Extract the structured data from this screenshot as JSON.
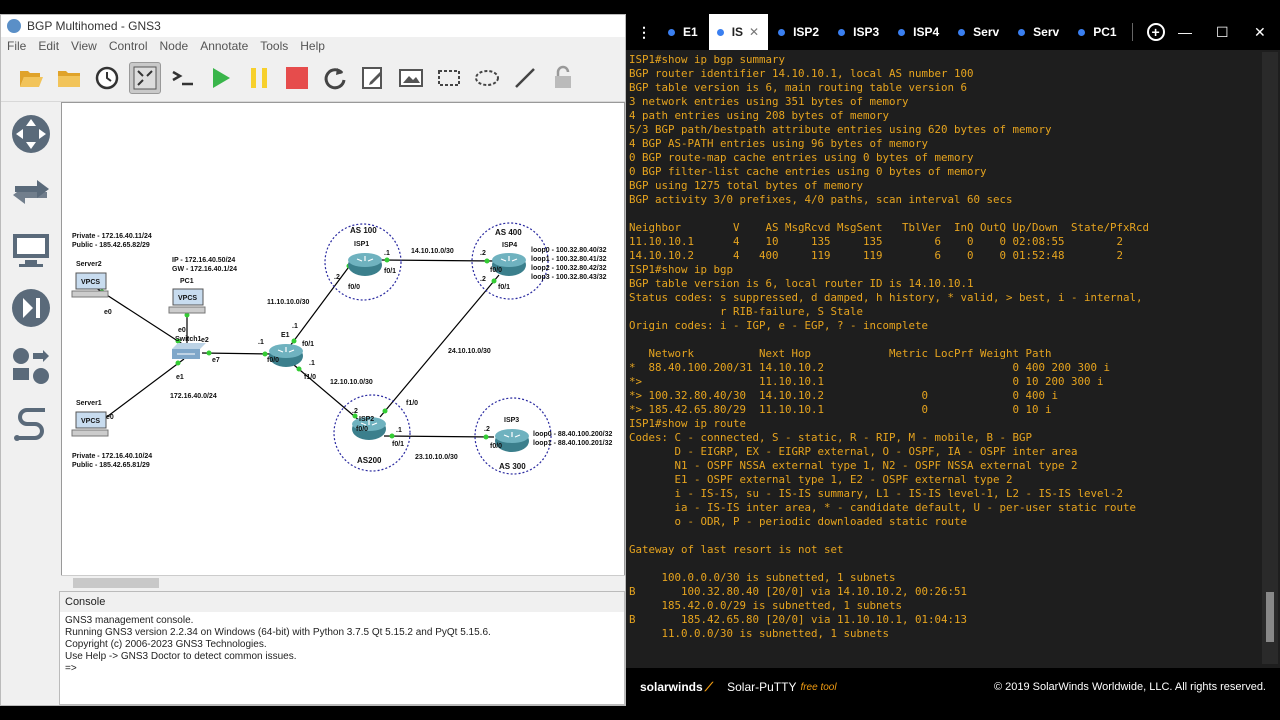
{
  "gns3": {
    "title": "BGP Multihomed - GNS3",
    "menu": [
      "File",
      "Edit",
      "View",
      "Control",
      "Node",
      "Annotate",
      "Tools",
      "Help"
    ],
    "toolbar_icons": [
      "folder-open-icon",
      "folder-icon",
      "clock-icon",
      "console-all-icon",
      "terminal-icon",
      "play-icon",
      "pause-icon",
      "stop-icon",
      "reload-icon",
      "edit-note-icon",
      "image-icon",
      "rectangle-icon",
      "ellipse-icon",
      "line-icon",
      "lock-icon"
    ],
    "left_icons": [
      "router-icon",
      "switch-icon",
      "end-device-icon",
      "security-device-icon",
      "all-devices-icon",
      "link-icon"
    ],
    "diagram": {
      "labels": {
        "server2_info_1": "Private - 172.16.40.11/24",
        "server2_info_2": "Public - 185.42.65.82/29",
        "server2": "Server2",
        "server1_info_1": "Private - 172.16.40.10/24",
        "server1_info_2": "Public - 185.42.65.81/29",
        "server1": "Server1",
        "pc1": "PC1",
        "pc1_ip": "IP - 172.16.40.50/24",
        "pc1_gw": "GW - 172.16.40.1/24",
        "switch1": "Switch1",
        "lan": "172.16.40.0/24",
        "e1": "E1",
        "as100": "AS 100",
        "isp1": "ISP1",
        "as400": "AS 400",
        "isp4": "ISP4",
        "as200": "AS200",
        "isp2": "ISP2",
        "as300": "AS 300",
        "isp3": "ISP3",
        "net_isp1_isp4": "14.10.10.0/30",
        "net_e1_isp1": "11.10.10.0/30",
        "net_e1_isp2": "12.10.10.0/30",
        "net_isp2_isp4": "24.10.10.0/30",
        "net_isp2_isp3": "23.10.10.0/30",
        "isp4_loop0": "loop0 - 100.32.80.40/32",
        "isp4_loop1": "loop1 - 100.32.80.41/32",
        "isp4_loop2": "loop2 - 100.32.80.42/32",
        "isp4_loop3": "loop3 - 100.32.80.43/32",
        "isp3_loop0": "loop0 - 88.40.100.200/32",
        "isp3_loop1": "loop1 - 88.40.100.201/32",
        "vpcs": "VPCS",
        "if_e0": "e0",
        "if_e1": "e1",
        "if_e2": "e2",
        "if_e7": "e7",
        "if_f00": "f0/0",
        "if_f01": "f0/1",
        "if_f10": "f1/0",
        "ip_1": ".1",
        "ip_2": ".2"
      }
    },
    "console": {
      "title": "Console",
      "lines": [
        "GNS3 management console.",
        "Running GNS3 version 2.2.34 on Windows (64-bit) with Python 3.7.5 Qt 5.15.2 and PyQt 5.15.6.",
        "Copyright (c) 2006-2023 GNS3 Technologies.",
        "Use Help -> GNS3 Doctor to detect common issues.",
        "",
        "=>"
      ]
    }
  },
  "putty": {
    "tabs": [
      {
        "label": "E1",
        "active": false
      },
      {
        "label": "IS",
        "active": true
      },
      {
        "label": "ISP2",
        "active": false
      },
      {
        "label": "ISP3",
        "active": false
      },
      {
        "label": "ISP4",
        "active": false
      },
      {
        "label": "Serv",
        "active": false
      },
      {
        "label": "Serv",
        "active": false
      },
      {
        "label": "PC1",
        "active": false
      }
    ],
    "window_buttons": {
      "minimize": "—",
      "maximize": "☐",
      "close": "✕"
    },
    "terminal_lines": [
      "ISP1#show ip bgp summary",
      "BGP router identifier 14.10.10.1, local AS number 100",
      "BGP table version is 6, main routing table version 6",
      "3 network entries using 351 bytes of memory",
      "4 path entries using 208 bytes of memory",
      "5/3 BGP path/bestpath attribute entries using 620 bytes of memory",
      "4 BGP AS-PATH entries using 96 bytes of memory",
      "0 BGP route-map cache entries using 0 bytes of memory",
      "0 BGP filter-list cache entries using 0 bytes of memory",
      "BGP using 1275 total bytes of memory",
      "BGP activity 3/0 prefixes, 4/0 paths, scan interval 60 secs",
      "",
      "Neighbor        V    AS MsgRcvd MsgSent   TblVer  InQ OutQ Up/Down  State/PfxRcd",
      "11.10.10.1      4    10     135     135        6    0    0 02:08:55        2",
      "14.10.10.2      4   400     119     119        6    0    0 01:52:48        2",
      "ISP1#show ip bgp",
      "BGP table version is 6, local router ID is 14.10.10.1",
      "Status codes: s suppressed, d damped, h history, * valid, > best, i - internal,",
      "              r RIB-failure, S Stale",
      "Origin codes: i - IGP, e - EGP, ? - incomplete",
      "",
      "   Network          Next Hop            Metric LocPrf Weight Path",
      "*  88.40.100.200/31 14.10.10.2                             0 400 200 300 i",
      "*>                  11.10.10.1                             0 10 200 300 i",
      "*> 100.32.80.40/30  14.10.10.2               0             0 400 i",
      "*> 185.42.65.80/29  11.10.10.1               0             0 10 i",
      "ISP1#show ip route",
      "Codes: C - connected, S - static, R - RIP, M - mobile, B - BGP",
      "       D - EIGRP, EX - EIGRP external, O - OSPF, IA - OSPF inter area",
      "       N1 - OSPF NSSA external type 1, N2 - OSPF NSSA external type 2",
      "       E1 - OSPF external type 1, E2 - OSPF external type 2",
      "       i - IS-IS, su - IS-IS summary, L1 - IS-IS level-1, L2 - IS-IS level-2",
      "       ia - IS-IS inter area, * - candidate default, U - per-user static route",
      "       o - ODR, P - periodic downloaded static route",
      "",
      "Gateway of last resort is not set",
      "",
      "     100.0.0.0/30 is subnetted, 1 subnets",
      "B       100.32.80.40 [20/0] via 14.10.10.2, 00:26:51",
      "     185.42.0.0/29 is subnetted, 1 subnets",
      "B       185.42.65.80 [20/0] via 11.10.10.1, 01:04:13",
      "     11.0.0.0/30 is subnetted, 1 subnets"
    ],
    "footer": {
      "brand": "solarwinds",
      "product": "Solar-PuTTY",
      "tag": "free tool",
      "copyright": "© 2019 SolarWinds Worldwide, LLC. All rights reserved."
    },
    "colors": {
      "terminal_text": "#e6a41f",
      "terminal_bg": "#1e1e1e",
      "accent": "#f29c11"
    }
  }
}
